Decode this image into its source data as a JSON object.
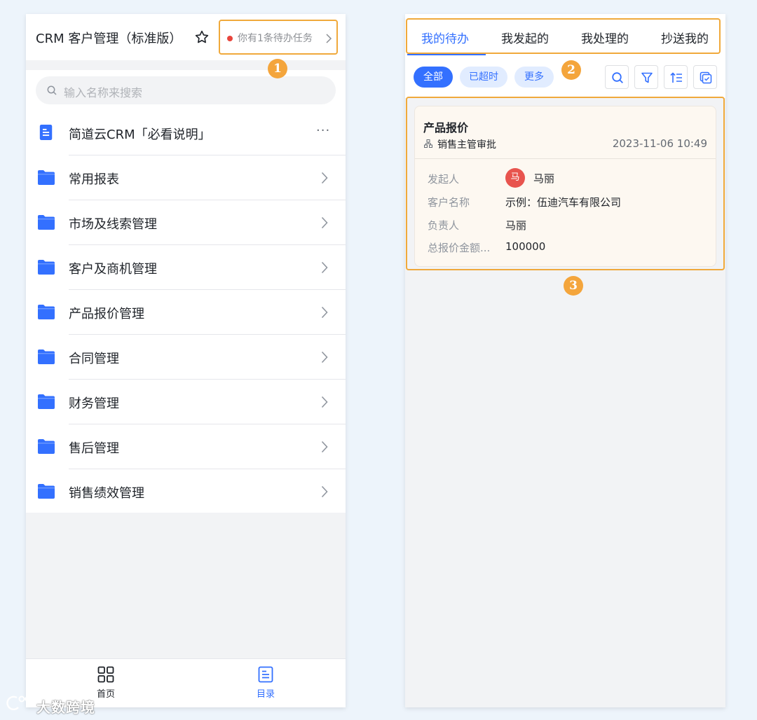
{
  "left": {
    "app_title": "CRM 客户管理（标准版）",
    "todo_banner": "你有1条待办任务",
    "marker": "1",
    "search_placeholder": "输入名称来搜索",
    "items": [
      {
        "label": "简道云CRM「必看说明」",
        "icon": "document-icon",
        "trailing": "···"
      },
      {
        "label": "常用报表",
        "icon": "folder-icon"
      },
      {
        "label": "市场及线索管理",
        "icon": "folder-icon"
      },
      {
        "label": "客户及商机管理",
        "icon": "folder-icon"
      },
      {
        "label": "产品报价管理",
        "icon": "folder-icon"
      },
      {
        "label": "合同管理",
        "icon": "folder-icon"
      },
      {
        "label": "财务管理",
        "icon": "folder-icon"
      },
      {
        "label": "售后管理",
        "icon": "folder-icon"
      },
      {
        "label": "销售绩效管理",
        "icon": "folder-icon"
      }
    ],
    "tabbar": {
      "home": "首页",
      "catalog": "目录"
    }
  },
  "right": {
    "tabs": [
      "我的待办",
      "我发起的",
      "我处理的",
      "抄送我的"
    ],
    "marker": "2",
    "chips": [
      "全部",
      "已超时",
      "更多"
    ],
    "card": {
      "title": "产品报价",
      "node": "销售主管审批",
      "date": "2023-11-06 10:49",
      "fields": [
        {
          "label": "发起人",
          "value": "马丽",
          "avatar": "马"
        },
        {
          "label": "客户名称",
          "value": "示例：伍迪汽车有限公司"
        },
        {
          "label": "负责人",
          "value": "马丽"
        },
        {
          "label": "总报价金额...",
          "value": "100000"
        }
      ]
    },
    "marker_card": "3"
  },
  "watermark": "大数跨境",
  "colors": {
    "accent": "#3370ff",
    "highlight": "#f0a93b",
    "alert_dot": "#e8453c",
    "folder": "#3370ff"
  }
}
